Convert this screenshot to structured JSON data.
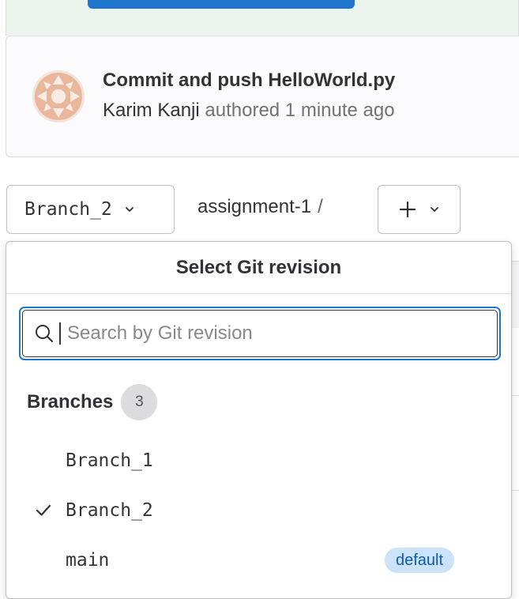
{
  "commit": {
    "title": "Commit and push HelloWorld.py",
    "author": "Karim Kanji",
    "authored_text": "authored 1 minute ago"
  },
  "ref_bar": {
    "current_branch": "Branch_2",
    "repo_name": "assignment-1",
    "separator": "/",
    "add_label": "+"
  },
  "dropdown": {
    "header": "Select Git revision",
    "search_placeholder": "Search by Git revision",
    "search_value": "",
    "group": {
      "label": "Branches",
      "count": "3",
      "items": [
        {
          "name": "Branch_1",
          "selected": false,
          "badge": ""
        },
        {
          "name": "Branch_2",
          "selected": true,
          "badge": ""
        },
        {
          "name": "main",
          "selected": false,
          "badge": "default"
        }
      ]
    }
  },
  "colors": {
    "accent": "#1f75cb",
    "badge_bg": "#cbe2f9",
    "badge_text": "#0b5cad",
    "alert_bg": "#ecf4ee"
  },
  "icons": {
    "chevron": "chevron-down-icon",
    "search": "search-icon",
    "check": "check-icon",
    "plus": "plus-icon"
  }
}
